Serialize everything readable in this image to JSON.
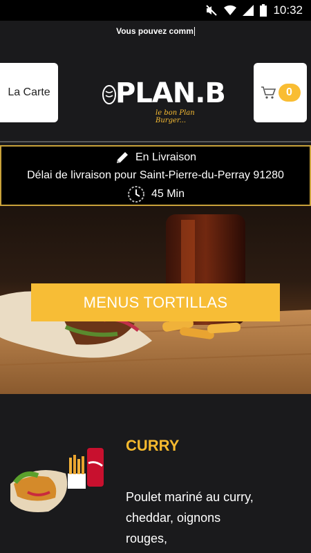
{
  "status_bar": {
    "time": "10:32"
  },
  "ticker": {
    "text": "Vous pouvez comm"
  },
  "header": {
    "menu_label": "La Carte",
    "cart_count": "0",
    "logo_main": "PLAN.B",
    "logo_subtitle": "le bon Plan Burger..."
  },
  "delivery": {
    "mode": "En Livraison",
    "info": "Délai de livraison pour Saint-Pierre-du-Perray 91280",
    "duration": "45 Min"
  },
  "hero": {
    "category_label": "MENUS TORTILLAS"
  },
  "menu_item": {
    "title": "CURRY",
    "description": "Poulet mariné au curry, cheddar, oignons rouges,"
  },
  "colors": {
    "accent": "#f7bd36",
    "border": "#c9a23a",
    "background": "#1a1a1c"
  }
}
